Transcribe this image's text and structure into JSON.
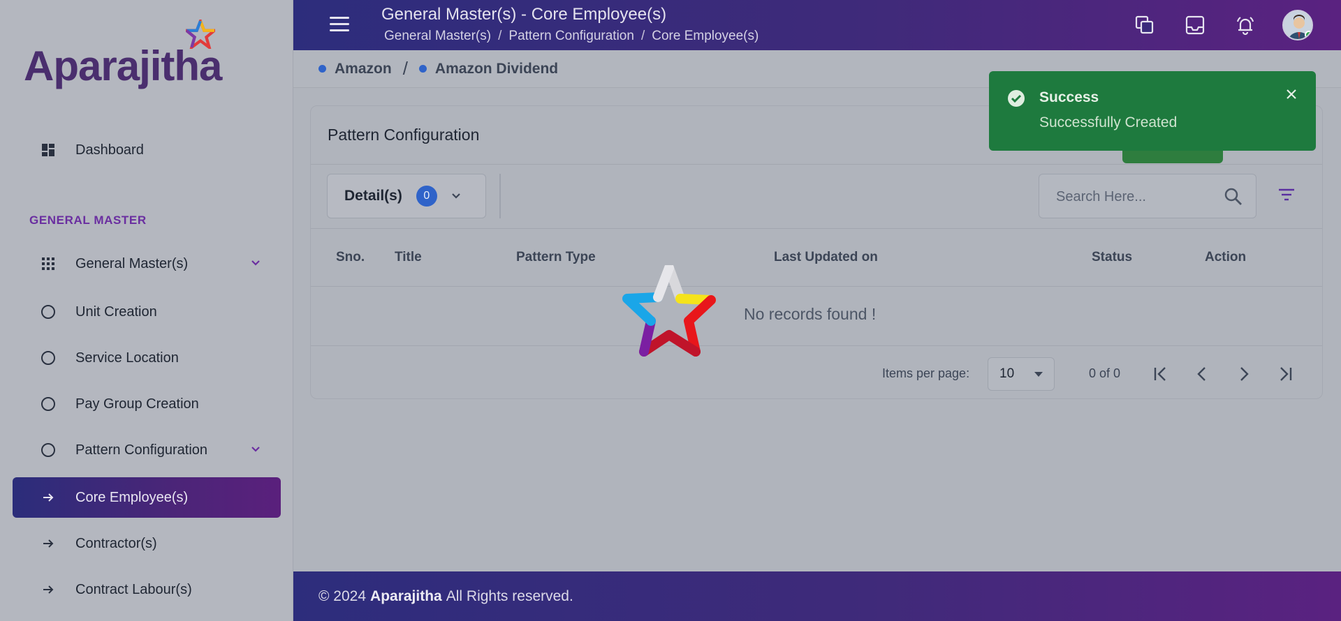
{
  "brand": {
    "name": "Aparajitha"
  },
  "sidebar": {
    "dashboard_label": "Dashboard",
    "section_title": "GENERAL MASTER",
    "items": [
      {
        "label": "General Master(s)"
      },
      {
        "label": "Unit Creation"
      },
      {
        "label": "Service Location"
      },
      {
        "label": "Pay Group Creation"
      },
      {
        "label": "Pattern Configuration"
      },
      {
        "label": "Core Employee(s)"
      },
      {
        "label": "Contractor(s)"
      },
      {
        "label": "Contract Labour(s)"
      }
    ]
  },
  "header": {
    "title": "General Master(s) - Core Employee(s)",
    "breadcrumb": [
      "General Master(s)",
      "/",
      "Pattern Configuration",
      "/",
      "Core Employee(s)"
    ],
    "icons": [
      "copy-icon",
      "inbox-icon",
      "bell-icon",
      "avatar"
    ]
  },
  "subbar": {
    "company": "Amazon",
    "separator": "/",
    "division": "Amazon Dividend"
  },
  "card": {
    "title": "Pattern Configuration",
    "details_label": "Detail(s)",
    "details_count": "0",
    "search_placeholder": "Search Here...",
    "columns": [
      "Sno.",
      "Title",
      "Pattern Type",
      "Last Updated on",
      "Status",
      "Action"
    ],
    "empty_text": "No records found !",
    "items_per_page_label": "Items per page:",
    "items_per_page_value": "10",
    "range_label": "0 of 0"
  },
  "toast": {
    "title": "Success",
    "message": "Successfully Created"
  },
  "footer": {
    "prefix": "© 2024",
    "brand": "Aparajitha",
    "suffix": "All Rights reserved."
  },
  "colors": {
    "accent": "#5a207c",
    "primary": "#2d2d7c",
    "success": "#1e7a3e",
    "badge": "#2f63c9"
  }
}
